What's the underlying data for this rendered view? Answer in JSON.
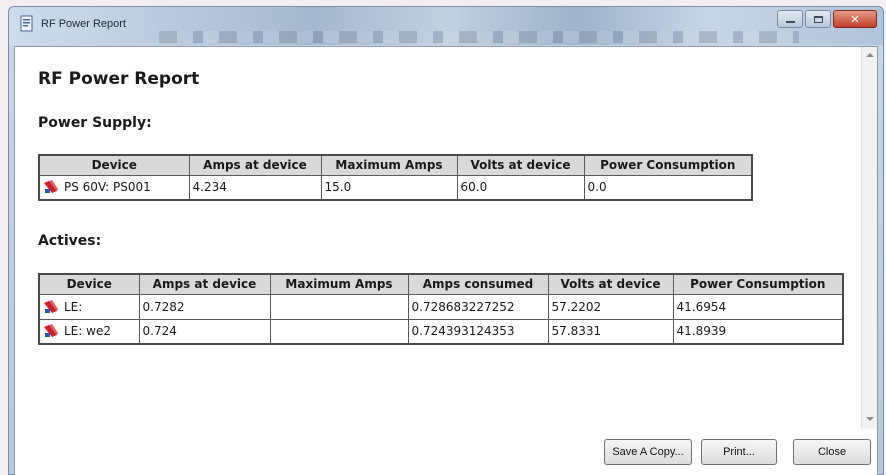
{
  "window": {
    "title": "RF Power Report"
  },
  "report": {
    "title": "RF Power Report",
    "power_supply": {
      "heading": "Power Supply:",
      "columns": [
        "Device",
        "Amps at device",
        "Maximum Amps",
        "Volts at device",
        "Power Consumption"
      ],
      "rows": [
        {
          "device": "PS 60V: PS001",
          "amps_at_device": "4.234",
          "maximum_amps": "15.0",
          "volts_at_device": "60.0",
          "power_consumption": "0.0"
        }
      ]
    },
    "actives": {
      "heading": "Actives:",
      "columns": [
        "Device",
        "Amps at device",
        "Maximum Amps",
        "Amps consumed",
        "Volts at device",
        "Power Consumption"
      ],
      "rows": [
        {
          "device": "LE:",
          "amps_at_device": "0.7282",
          "maximum_amps": "",
          "amps_consumed": "0.728683227252",
          "volts_at_device": "57.2202",
          "power_consumption": "41.6954"
        },
        {
          "device": "LE: we2",
          "amps_at_device": "0.724",
          "maximum_amps": "",
          "amps_consumed": "0.724393124353",
          "volts_at_device": "57.8331",
          "power_consumption": "41.8939"
        }
      ]
    }
  },
  "buttons": {
    "save_copy": "Save A Copy...",
    "print": "Print...",
    "close": "Close"
  },
  "icons": {
    "app": "report-window-icon",
    "device": "rf-device-icon"
  },
  "colors": {
    "device_icon_red": "#c8232c",
    "device_icon_blue": "#2b58a8"
  }
}
